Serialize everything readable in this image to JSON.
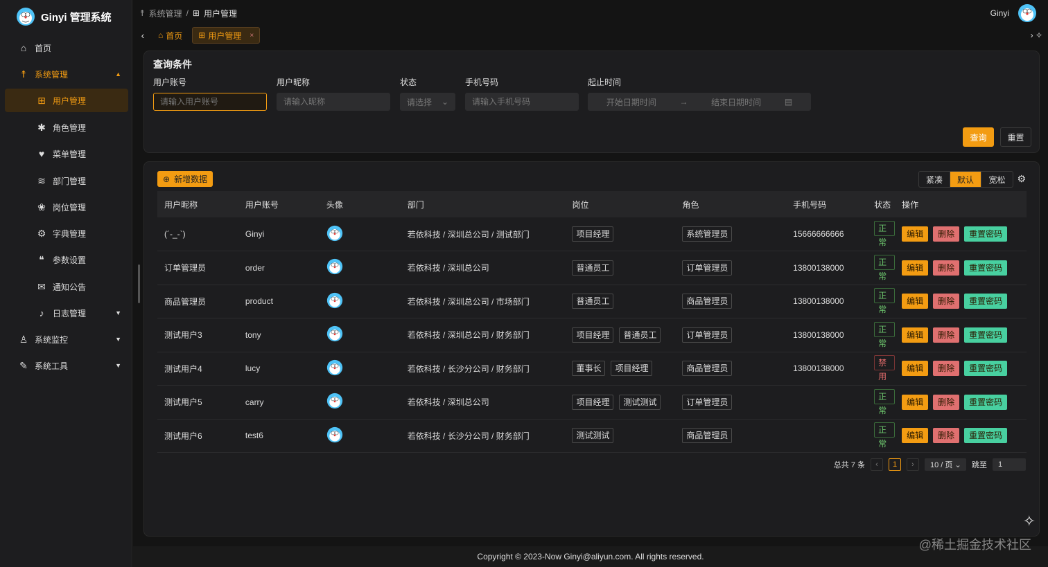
{
  "app": {
    "title": "Ginyi 管理系统",
    "user": "Ginyi"
  },
  "sidebar": {
    "items": [
      {
        "label": "首页",
        "icon": "home-icon"
      },
      {
        "label": "系统管理",
        "icon": "system-icon"
      },
      {
        "label": "用户管理",
        "icon": "user-manage-icon"
      },
      {
        "label": "角色管理",
        "icon": "role-icon"
      },
      {
        "label": "菜单管理",
        "icon": "heart-icon"
      },
      {
        "label": "部门管理",
        "icon": "layers-icon"
      },
      {
        "label": "岗位管理",
        "icon": "paw-icon"
      },
      {
        "label": "字典管理",
        "icon": "gear-icon"
      },
      {
        "label": "参数设置",
        "icon": "chat-icon"
      },
      {
        "label": "通知公告",
        "icon": "mail-icon"
      },
      {
        "label": "日志管理",
        "icon": "mic-icon"
      },
      {
        "label": "系统监控",
        "icon": "person-icon"
      },
      {
        "label": "系统工具",
        "icon": "wrench-icon"
      }
    ]
  },
  "breadcrumb": {
    "parent": "系统管理",
    "sep": "/",
    "current": "用户管理"
  },
  "tabs": {
    "home": "首页",
    "active": "用户管理",
    "close": "×"
  },
  "query": {
    "title": "查询条件",
    "account_label": "用户账号",
    "account_ph": "请输入用户账号",
    "nickname_label": "用户昵称",
    "nickname_ph": "请输入昵称",
    "status_label": "状态",
    "status_ph": "请选择",
    "phone_label": "手机号码",
    "phone_ph": "请输入手机号码",
    "time_label": "起止时间",
    "start_ph": "开始日期时间",
    "end_ph": "结束日期时间",
    "arrow": "→",
    "search": "查询",
    "reset": "重置"
  },
  "toolbar": {
    "add": "新增数据",
    "sizes": [
      "紧凑",
      "默认",
      "宽松"
    ]
  },
  "table": {
    "headers": [
      "用户昵称",
      "用户账号",
      "头像",
      "部门",
      "岗位",
      "角色",
      "手机号码",
      "状态",
      "操作"
    ],
    "actions": {
      "edit": "编辑",
      "delete": "删除",
      "reset": "重置密码"
    },
    "rows": [
      {
        "nick": "(´-_-`)",
        "account": "Ginyi",
        "dept": "若依科技 / 深圳总公司 / 测试部门",
        "posts": [
          "项目经理"
        ],
        "role": "系统管理员",
        "phone": "15666666666",
        "status": "正常",
        "ok": true
      },
      {
        "nick": "订单管理员",
        "account": "order",
        "dept": "若依科技 / 深圳总公司",
        "posts": [
          "普通员工"
        ],
        "role": "订单管理员",
        "phone": "13800138000",
        "status": "正常",
        "ok": true
      },
      {
        "nick": "商品管理员",
        "account": "product",
        "dept": "若依科技 / 深圳总公司 / 市场部门",
        "posts": [
          "普通员工"
        ],
        "role": "商品管理员",
        "phone": "13800138000",
        "status": "正常",
        "ok": true
      },
      {
        "nick": "测试用户3",
        "account": "tony",
        "dept": "若依科技 / 深圳总公司 / 财务部门",
        "posts": [
          "项目经理",
          "普通员工"
        ],
        "role": "订单管理员",
        "phone": "13800138000",
        "status": "正常",
        "ok": true
      },
      {
        "nick": "测试用户4",
        "account": "lucy",
        "dept": "若依科技 / 长沙分公司 / 财务部门",
        "posts": [
          "董事长",
          "项目经理"
        ],
        "role": "商品管理员",
        "phone": "13800138000",
        "status": "禁用",
        "ok": false
      },
      {
        "nick": "测试用户5",
        "account": "carry",
        "dept": "若依科技 / 深圳总公司",
        "posts": [
          "项目经理",
          "测试测试"
        ],
        "role": "订单管理员",
        "phone": "",
        "status": "正常",
        "ok": true
      },
      {
        "nick": "测试用户6",
        "account": "test6",
        "dept": "若依科技 / 长沙分公司 / 财务部门",
        "posts": [
          "测试测试"
        ],
        "role": "商品管理员",
        "phone": "",
        "status": "正常",
        "ok": true
      }
    ]
  },
  "pagination": {
    "total": "总共 7 条",
    "page": "1",
    "size": "10 / 页",
    "jump_label": "跳至",
    "jump_value": "1"
  },
  "footer": "Copyright © 2023-Now Ginyi@aliyun.com. All rights reserved.",
  "watermark": "@稀土掘金技术社区",
  "colors": {
    "accent": "#f39c12",
    "bg": "#141414",
    "panel": "#1d1d1f"
  }
}
